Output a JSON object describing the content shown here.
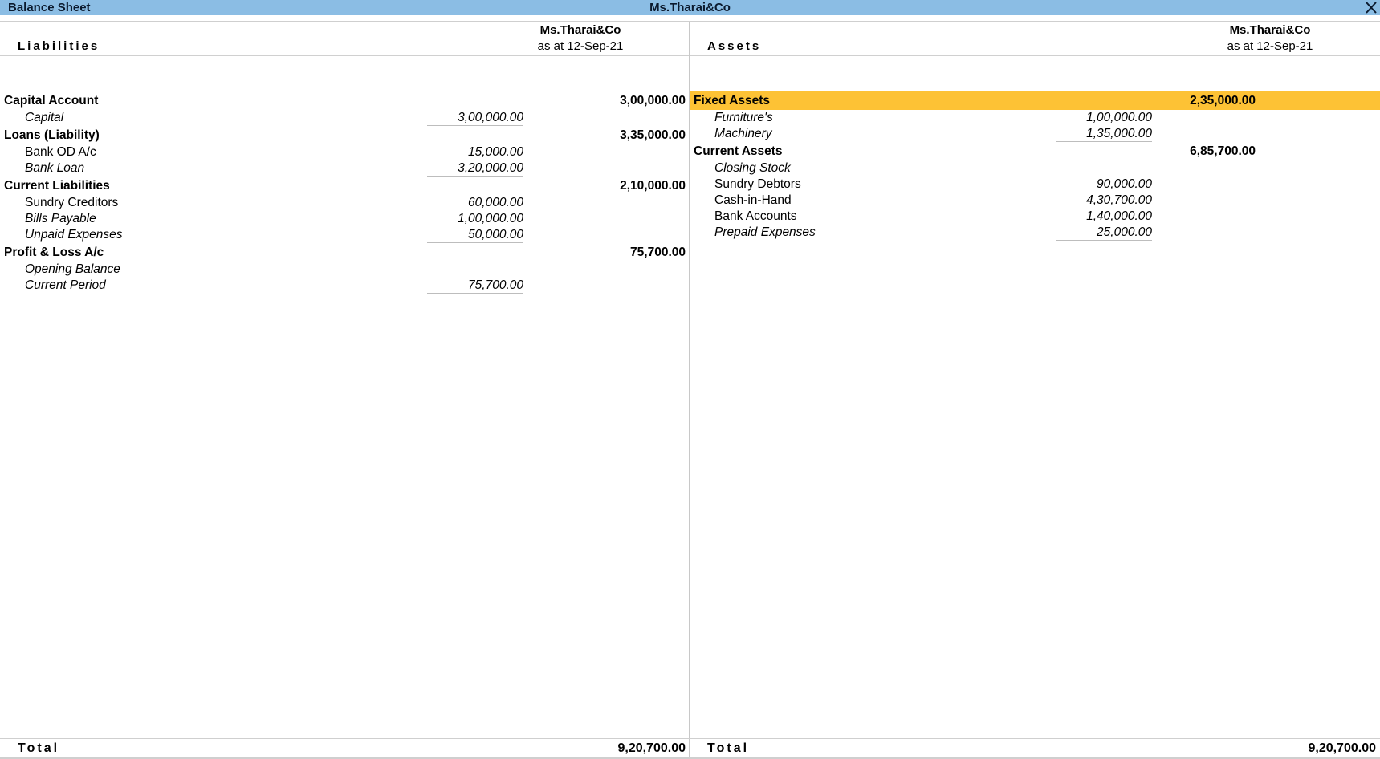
{
  "window": {
    "title": "Balance Sheet",
    "company": "Ms.Tharai&Co",
    "close_icon": "close-icon"
  },
  "colors": {
    "titlebar_bg": "#8BBDE4",
    "highlight_bg": "#FDC235"
  },
  "liabilities": {
    "heading": "Liabilities",
    "company": "Ms.Tharai&Co",
    "as_at": "as at 12-Sep-21",
    "groups": [
      {
        "name": "Capital Account",
        "amount": "3,00,000.00",
        "items": [
          {
            "name": "Capital",
            "amount": "3,00,000.00",
            "italic": true
          }
        ]
      },
      {
        "name": "Loans (Liability)",
        "amount": "3,35,000.00",
        "items": [
          {
            "name": "Bank OD A/c",
            "amount": "15,000.00",
            "italic": false
          },
          {
            "name": "Bank Loan",
            "amount": "3,20,000.00",
            "italic": true
          }
        ]
      },
      {
        "name": "Current Liabilities",
        "amount": "2,10,000.00",
        "items": [
          {
            "name": "Sundry Creditors",
            "amount": "60,000.00",
            "italic": false
          },
          {
            "name": "Bills Payable",
            "amount": "1,00,000.00",
            "italic": true
          },
          {
            "name": "Unpaid Expenses",
            "amount": "50,000.00",
            "italic": true
          }
        ]
      },
      {
        "name": "Profit & Loss A/c",
        "amount": "75,700.00",
        "items": [
          {
            "name": "Opening Balance",
            "amount": "",
            "italic": true
          },
          {
            "name": "Current Period",
            "amount": "75,700.00",
            "italic": true
          }
        ]
      }
    ],
    "total_label": "Total",
    "total": "9,20,700.00"
  },
  "assets": {
    "heading": "Assets",
    "company": "Ms.Tharai&Co",
    "as_at": "as at 12-Sep-21",
    "groups": [
      {
        "name": "Fixed Assets",
        "amount": "2,35,000.00",
        "selected": true,
        "items": [
          {
            "name": "Furniture's",
            "amount": "1,00,000.00",
            "italic": true
          },
          {
            "name": "Machinery",
            "amount": "1,35,000.00",
            "italic": true
          }
        ]
      },
      {
        "name": "Current Assets",
        "amount": "6,85,700.00",
        "selected": false,
        "items": [
          {
            "name": "Closing Stock",
            "amount": "",
            "italic": true
          },
          {
            "name": "Sundry Debtors",
            "amount": "90,000.00",
            "italic": false
          },
          {
            "name": "Cash-in-Hand",
            "amount": "4,30,700.00",
            "italic": false
          },
          {
            "name": "Bank Accounts",
            "amount": "1,40,000.00",
            "italic": false
          },
          {
            "name": "Prepaid Expenses",
            "amount": "25,000.00",
            "italic": true
          }
        ]
      }
    ],
    "total_label": "Total",
    "total": "9,20,700.00"
  }
}
